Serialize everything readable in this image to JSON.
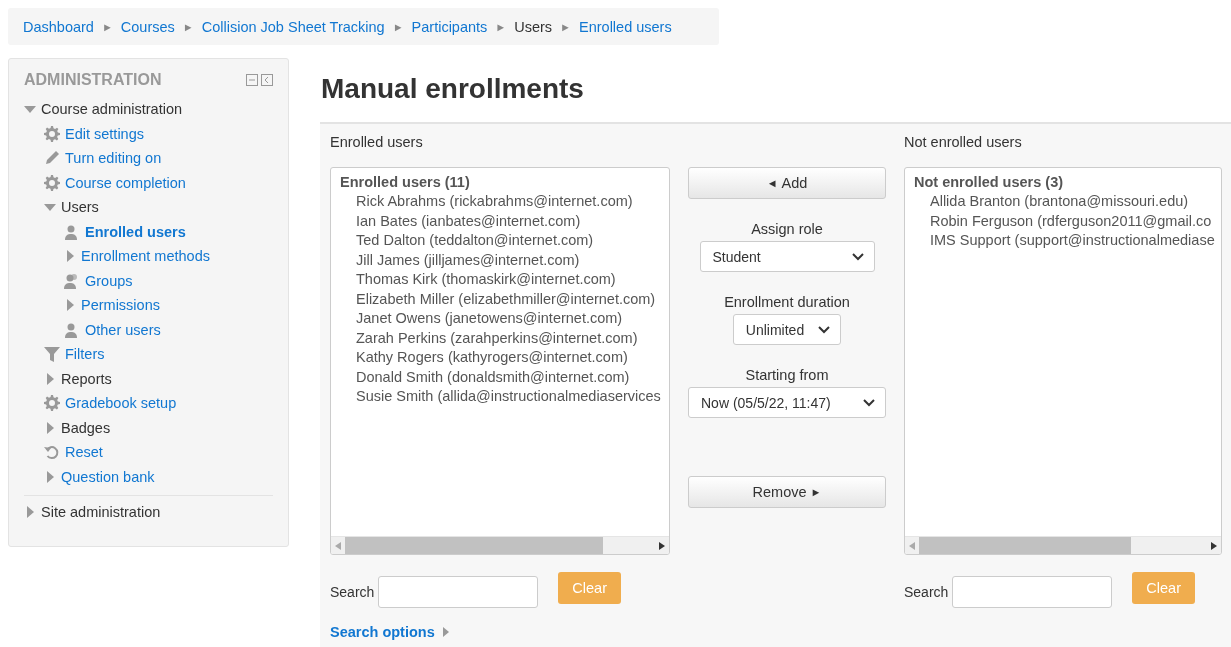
{
  "breadcrumb": [
    {
      "label": "Dashboard",
      "kind": "link"
    },
    {
      "label": "►",
      "kind": "separator"
    },
    {
      "label": "Courses",
      "kind": "link"
    },
    {
      "label": "►",
      "kind": "separator"
    },
    {
      "label": "Collision Job Sheet Tracking",
      "kind": "link"
    },
    {
      "label": "►",
      "kind": "separator"
    },
    {
      "label": "Participants",
      "kind": "link"
    },
    {
      "label": "►",
      "kind": "separator"
    },
    {
      "label": "Users",
      "kind": "text"
    },
    {
      "label": "►",
      "kind": "separator"
    },
    {
      "label": "Enrolled users",
      "kind": "link"
    }
  ],
  "sidebar": {
    "title": "ADMINISTRATION",
    "items": [
      {
        "label": "Course administration",
        "kind": "branch",
        "expanded": true,
        "selected": false,
        "children": [
          {
            "label": "Edit settings",
            "kind": "gear",
            "selected": false
          },
          {
            "label": "Turn editing on",
            "kind": "pencil",
            "selected": false
          },
          {
            "label": "Course completion",
            "kind": "gear",
            "selected": false
          },
          {
            "label": "Users",
            "kind": "branch",
            "expanded": true,
            "selected": false,
            "children": [
              {
                "label": "Enrolled users",
                "kind": "user",
                "selected": true
              },
              {
                "label": "Enrollment methods",
                "kind": "branch-link",
                "expanded": false,
                "selected": false
              },
              {
                "label": "Groups",
                "kind": "group",
                "selected": false
              },
              {
                "label": "Permissions",
                "kind": "branch-link",
                "expanded": false,
                "selected": false
              },
              {
                "label": "Other users",
                "kind": "user",
                "selected": false
              }
            ]
          },
          {
            "label": "Filters",
            "kind": "filter",
            "selected": false
          },
          {
            "label": "Reports",
            "kind": "branch",
            "expanded": false,
            "selected": false
          },
          {
            "label": "Gradebook setup",
            "kind": "gear",
            "selected": false
          },
          {
            "label": "Badges",
            "kind": "branch",
            "expanded": false,
            "selected": false
          },
          {
            "label": "Reset",
            "kind": "reset",
            "selected": false
          },
          {
            "label": "Question bank",
            "kind": "branch-link",
            "expanded": false,
            "selected": false
          }
        ]
      },
      {
        "label": "Site administration",
        "kind": "branch",
        "expanded": false,
        "selected": false
      }
    ]
  },
  "title": "Manual enrollments",
  "enrolled": {
    "label": "Enrolled users",
    "group": "Enrolled users (11)",
    "users": [
      "Rick Abrahms (rickabrahms@internet.com)",
      "Ian Bates (ianbates@internet.com)",
      "Ted Dalton (teddalton@internet.com)",
      "Jill James (jilljames@internet.com)",
      "Thomas Kirk (thomaskirk@internet.com)",
      "Elizabeth Miller (elizabethmiller@internet.com)",
      "Janet Owens (janetowens@internet.com)",
      "Zarah Perkins (zarahperkins@internet.com)",
      "Kathy Rogers (kathyrogers@internet.com)",
      "Donald Smith (donaldsmith@internet.com)",
      "Susie Smith (allida@instructionalmediaservices"
    ],
    "search_label": "Search",
    "clear": "Clear"
  },
  "not_enrolled": {
    "label": "Not enrolled users",
    "group": "Not enrolled users (3)",
    "users": [
      "Allida Branton (brantona@missouri.edu)",
      "Robin Ferguson (rdferguson2011@gmail.co",
      "IMS Support (support@instructionalmediase"
    ],
    "search_label": "Search",
    "clear": "Clear"
  },
  "controls": {
    "add": {
      "arrow": "◄",
      "label": "Add"
    },
    "remove": {
      "arrow": "►",
      "label": "Remove"
    },
    "fields": [
      {
        "label": "Assign role",
        "value": "Student"
      },
      {
        "label": "Enrollment duration",
        "value": "Unlimited"
      },
      {
        "label": "Starting from",
        "value": "Now (05/5/22, 11:47)"
      }
    ]
  },
  "search_options": {
    "label": "Search options",
    "expanded": false
  }
}
